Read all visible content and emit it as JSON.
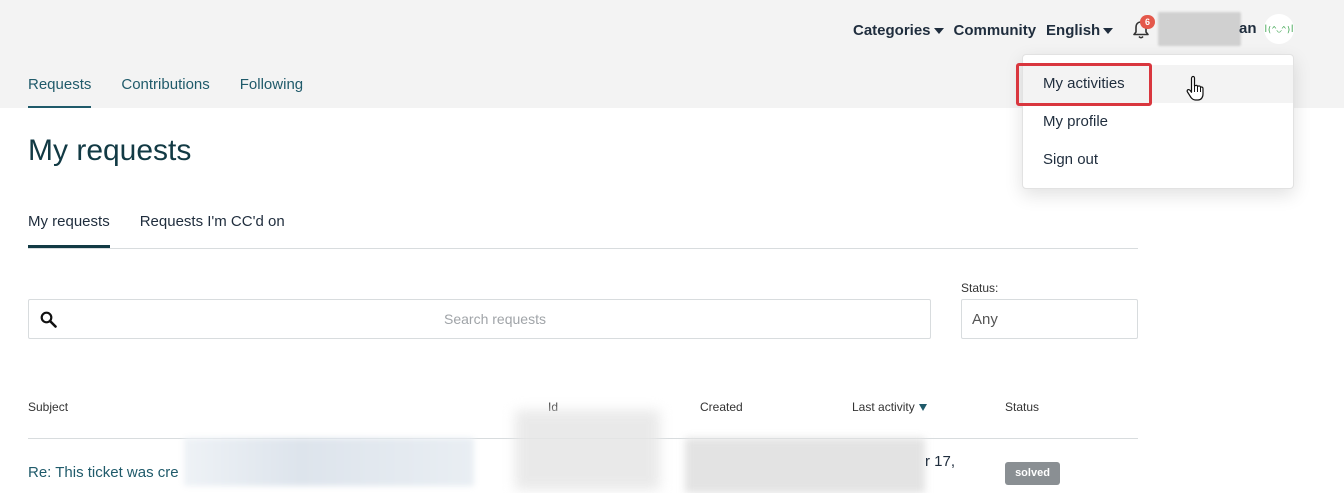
{
  "header": {
    "nav": [
      {
        "label": "Categories",
        "has_caret": true
      },
      {
        "label": "Community",
        "has_caret": false
      },
      {
        "label": "English",
        "has_caret": true
      }
    ],
    "notification_count": "6",
    "user_name_visible_tail": "an",
    "avatar_text": "ꟾ(^◡^)ꟾ"
  },
  "subtabs": [
    {
      "label": "Requests",
      "active": true
    },
    {
      "label": "Contributions",
      "active": false
    },
    {
      "label": "Following",
      "active": false
    }
  ],
  "page_title": "My requests",
  "request_tabs": [
    {
      "label": "My requests",
      "active": true
    },
    {
      "label": "Requests I'm CC'd on",
      "active": false
    }
  ],
  "search": {
    "placeholder": "Search requests",
    "value": ""
  },
  "status_filter": {
    "label": "Status:",
    "value": "Any"
  },
  "table": {
    "columns": [
      "Subject",
      "Id",
      "Created",
      "Last activity",
      "Status"
    ],
    "sorted_column": "Last activity",
    "rows": [
      {
        "subject": "Re: This ticket was cre",
        "last_activity_tail": "r 17,",
        "status": "solved"
      }
    ]
  },
  "user_menu": {
    "items": [
      "My activities",
      "My profile",
      "Sign out"
    ],
    "highlighted": "My activities"
  },
  "colors": {
    "header_bg": "#f3f3f3",
    "link": "#1f5a6a",
    "badge": "#e4584b",
    "highlight": "#d9363e",
    "status_solved": "#8a8f93"
  }
}
